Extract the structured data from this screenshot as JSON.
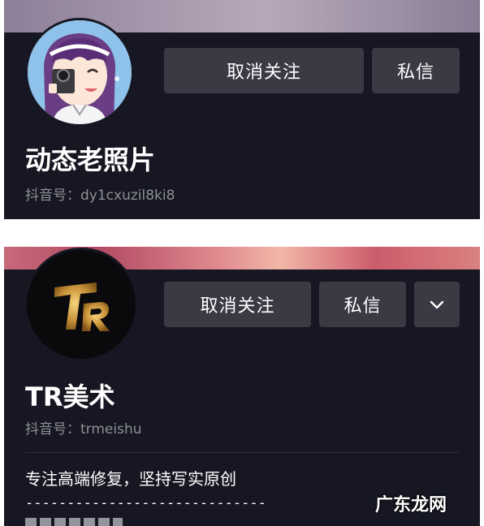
{
  "profiles": [
    {
      "follow_button": "取消关注",
      "message_button": "私信",
      "name": "动态老照片",
      "handle": "抖音号：dy1cxuzil8ki8"
    },
    {
      "follow_button": "取消关注",
      "message_button": "私信",
      "name": "TR美术",
      "handle": "抖音号：trmeishu",
      "bio_line1": "专注高端修复，坚持写实原创",
      "bio_line2": "-----------------------------"
    }
  ],
  "watermark": "广东龙网",
  "colors": {
    "card_background": "#161722",
    "button_background": "#393a44",
    "handle_text": "#8e8f96"
  },
  "icons": {
    "more_dropdown": "chevron-down-icon"
  }
}
